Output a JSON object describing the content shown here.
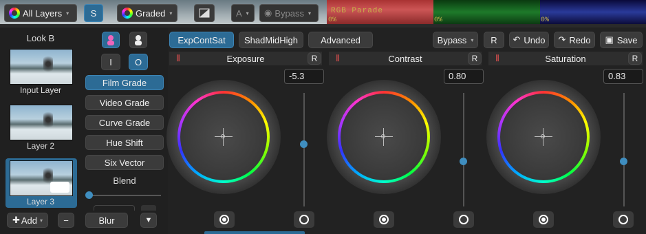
{
  "toolbar": {
    "layers_dropdown": "All Layers",
    "solo_button": "S",
    "graded_dropdown": "Graded",
    "compare_letter": "A",
    "bypass_dropdown": "Bypass"
  },
  "scope": {
    "label": "RGB Parade",
    "percent_labels": [
      "0%",
      "0%",
      "0%"
    ]
  },
  "look": {
    "title": "Look B"
  },
  "layers": [
    {
      "label": "Input Layer"
    },
    {
      "label": "Layer 2"
    },
    {
      "label": "Layer 3"
    }
  ],
  "layer_actions": {
    "add": "Add",
    "remove": "−"
  },
  "io": {
    "input": "I",
    "output": "O"
  },
  "grade_modes": [
    "Film Grade",
    "Video Grade",
    "Curve Grade",
    "Hue Shift",
    "Six Vector"
  ],
  "blend": {
    "label": "Blend"
  },
  "blur": {
    "label": "Blur"
  },
  "tabs": [
    "ExpContSat",
    "ShadMidHigh",
    "Advanced"
  ],
  "actions": {
    "bypass": "Bypass",
    "reset": "R",
    "undo": "Undo",
    "redo": "Redo",
    "save": "Save"
  },
  "wheels": [
    {
      "name": "Exposure",
      "value": "-5.3",
      "reset": "R",
      "slider_fraction": 0.55
    },
    {
      "name": "Contrast",
      "value": "0.80",
      "reset": "R",
      "slider_fraction": 0.4
    },
    {
      "name": "Saturation",
      "value": "0.83",
      "reset": "R",
      "slider_fraction": 0.4
    }
  ],
  "colors": {
    "accent": "#2c6b95",
    "knob": "#3f8ec0",
    "scope_text": "#c6b34a"
  }
}
